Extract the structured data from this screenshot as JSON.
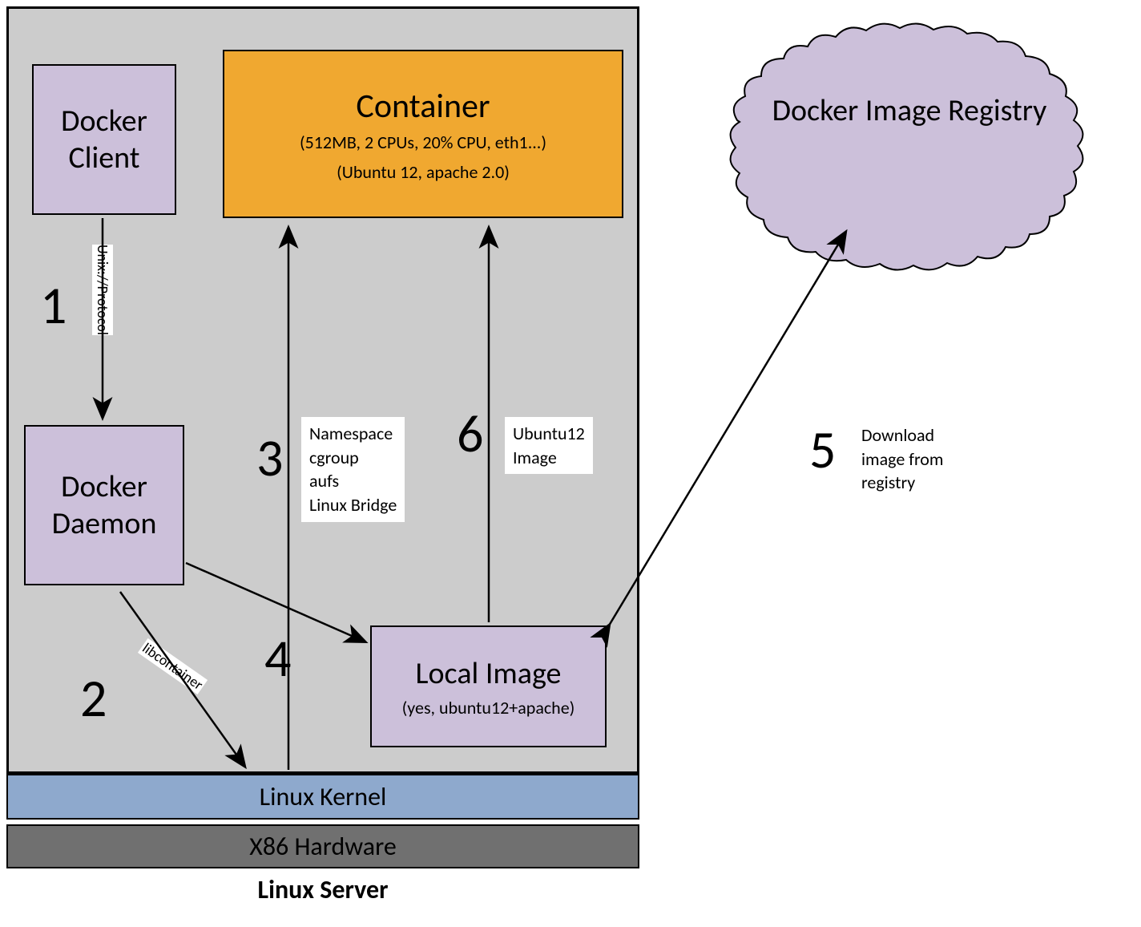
{
  "server_caption": "Linux Server",
  "hardware": "X86 Hardware",
  "kernel": "Linux Kernel",
  "docker_client": {
    "line1": "Docker",
    "line2": "Client"
  },
  "docker_daemon": {
    "line1": "Docker",
    "line2": "Daemon"
  },
  "container": {
    "title": "Container",
    "specs": "(512MB, 2 CPUs, 20% CPU, eth1...)",
    "stack": "(Ubuntu 12, apache 2.0)"
  },
  "local_image": {
    "title": "Local Image",
    "detail": "(yes, ubuntu12+apache)"
  },
  "registry": "Docker Image Registry",
  "edges": {
    "unix_protocol": "Unix://Protocol",
    "libcontainer": "libcontainer"
  },
  "notes": {
    "kernel_features": "Namespace\ncgroup\naufs\nLinux Bridge",
    "ubuntu_image": "Ubuntu12\nImage",
    "download": "Download\nimage from\nregistry"
  },
  "steps": {
    "s1": "1",
    "s2": "2",
    "s3": "3",
    "s4": "4",
    "s5": "5",
    "s6": "6"
  }
}
